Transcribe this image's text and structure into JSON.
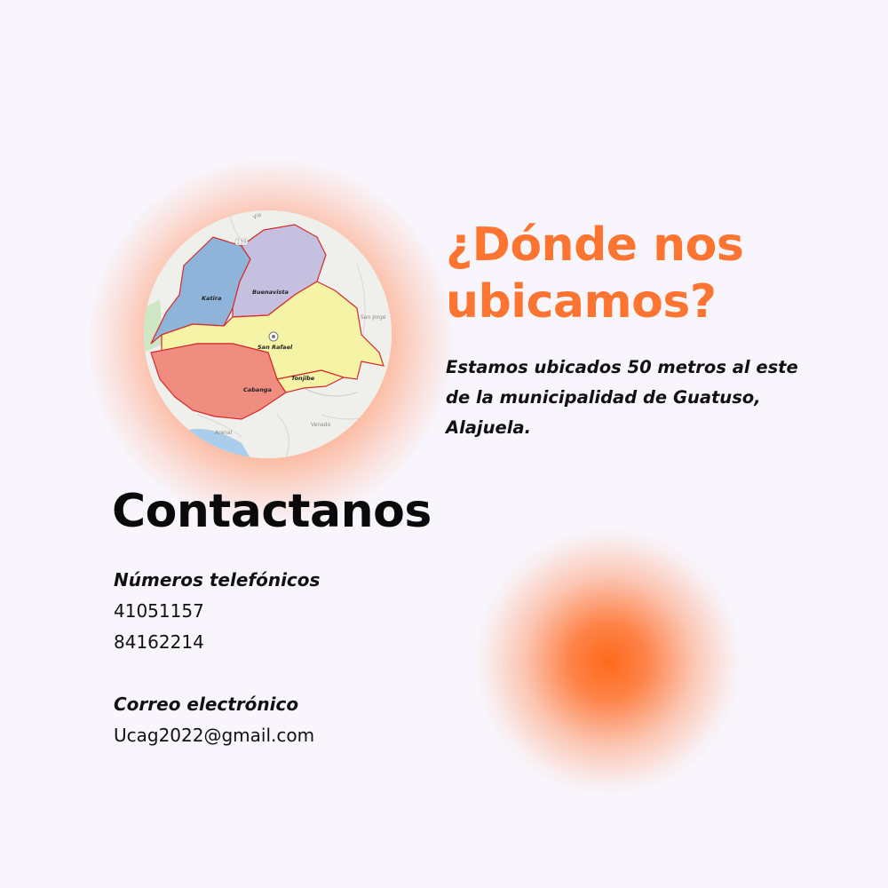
{
  "location": {
    "heading": "¿Dónde nos ubicamos?",
    "description": "Estamos ubicados 50 metros al este de la municipalidad de Guatuso, Alajuela.",
    "map": {
      "regions": [
        "Katira",
        "Buenavista",
        "San Rafael",
        "Tonjibe",
        "Cabanga"
      ],
      "places": [
        "San Jorge",
        "Venado",
        "Arenal",
        "Vía"
      ],
      "road_number": "139",
      "colors": {
        "katira": "#8fb4d9",
        "buenavista": "#c5bfe0",
        "san_rafael": "#f5f3a6",
        "cabanga": "#ee8d80",
        "border": "#d42a2a"
      }
    }
  },
  "contact": {
    "title": "Contactanos",
    "phones_label": "Números telefónicos",
    "phones": [
      "41051157",
      "84162214"
    ],
    "email_label": "Correo electrónico",
    "email": "Ucag2022@gmail.com"
  },
  "colors": {
    "accent": "#ff7430",
    "background": "#f8f6fc"
  }
}
